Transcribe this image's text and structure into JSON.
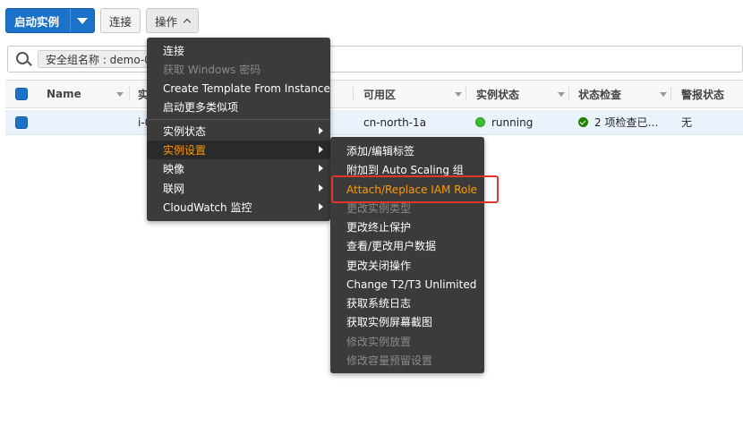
{
  "toolbar": {
    "launch_label": "启动实例",
    "connect_label": "连接",
    "actions_label": "操作"
  },
  "search": {
    "tag": "安全组名称 : demo-0"
  },
  "table": {
    "columns": {
      "name": "Name",
      "instance_id": "实",
      "az": "可用区",
      "state": "实例状态",
      "status_check": "状态检查",
      "alarm": "警报状态"
    },
    "row": {
      "name": "",
      "instance_id": "i-0",
      "az": "cn-north-1a",
      "state": "running",
      "status_check": "2 项检查已…",
      "alarm": "无"
    }
  },
  "actions_menu": {
    "items": [
      {
        "label": "连接",
        "enabled": true
      },
      {
        "label": "获取 Windows 密码",
        "enabled": false
      },
      {
        "label": "Create Template From Instance",
        "enabled": true
      },
      {
        "label": "启动更多类似项",
        "enabled": true
      },
      {
        "label": "实例状态",
        "enabled": true,
        "submenu": true
      },
      {
        "label": "实例设置",
        "enabled": true,
        "submenu": true,
        "active": true
      },
      {
        "label": "映像",
        "enabled": true,
        "submenu": true
      },
      {
        "label": "联网",
        "enabled": true,
        "submenu": true
      },
      {
        "label": "CloudWatch 监控",
        "enabled": true,
        "submenu": true
      }
    ]
  },
  "instance_settings_menu": {
    "items": [
      {
        "label": "添加/编辑标签",
        "enabled": true
      },
      {
        "label": "附加到 Auto Scaling 组",
        "enabled": true
      },
      {
        "label": "Attach/Replace IAM Role",
        "enabled": true,
        "highlighted": true
      },
      {
        "label": "更改实例类型",
        "enabled": false
      },
      {
        "label": "更改终止保护",
        "enabled": true
      },
      {
        "label": "查看/更改用户数据",
        "enabled": true
      },
      {
        "label": "更改关闭操作",
        "enabled": true
      },
      {
        "label": "Change T2/T3 Unlimited",
        "enabled": true
      },
      {
        "label": "获取系统日志",
        "enabled": true
      },
      {
        "label": "获取实例屏幕截图",
        "enabled": true
      },
      {
        "label": "修改实例放置",
        "enabled": false
      },
      {
        "label": "修改容量预留设置",
        "enabled": false
      }
    ]
  },
  "colors": {
    "primary": "#1a73c8",
    "menu_bg": "#3b3b3b",
    "accent": "#ff9900",
    "highlight_box": "#e0362b",
    "running": "#39c12d"
  }
}
